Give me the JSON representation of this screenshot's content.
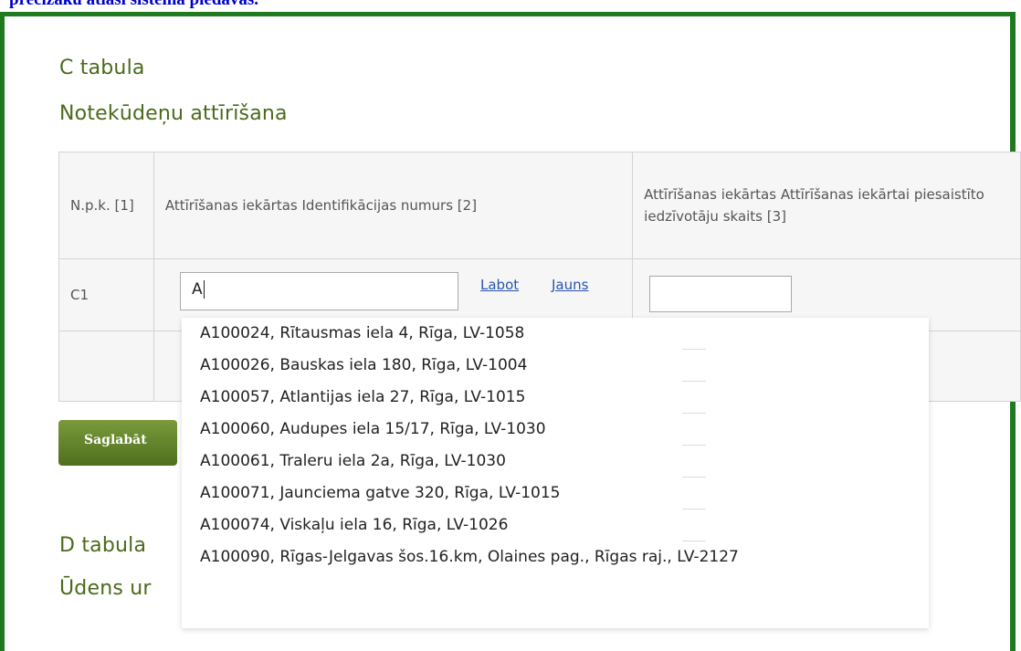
{
  "top_caption": "precizāku atlasi sistēma piedāvās.",
  "section_c": {
    "title_line1": "C tabula",
    "title_line2": "Notekūdeņu attīrīšana",
    "columns": [
      "N.p.k. [1]",
      "Attīrīšanas iekārtas Identifikācijas numurs [2]",
      "Attīrīšanas iekārtas Attīrīšanas iekārtai piesaistīto iedzīvotāju skaits [3]"
    ],
    "row": {
      "npk": "C1",
      "id_value": "A",
      "edit_link": "Labot",
      "new_link": "Jauns",
      "count_value": ""
    }
  },
  "save_button": "Saglabāt",
  "section_d": {
    "title_line1": "D tabula",
    "title_line2": "Ūdens ur"
  },
  "autocomplete_options": [
    "A100024, Rītausmas iela 4, Rīga, LV-1058",
    "A100026, Bauskas iela 180, Rīga, LV-1004",
    "A100057, Atlantijas iela 27, Rīga, LV-1015",
    "A100060, Audupes iela 15/17, Rīga, LV-1030",
    "A100061, Traleru iela 2a, Rīga, LV-1030",
    "A100071, Jaunciema gatve 320, Rīga, LV-1015",
    "A100074, Viskaļu iela 16, Rīga, LV-1026",
    "A100090, Rīgas-Jelgavas šos.16.km, Olaines pag., Rīgas raj., LV-2127"
  ],
  "colors": {
    "frame_border": "#1f7a1f",
    "heading": "#4a6a1b",
    "link": "#2a55b0",
    "caption": "#0000cc"
  }
}
